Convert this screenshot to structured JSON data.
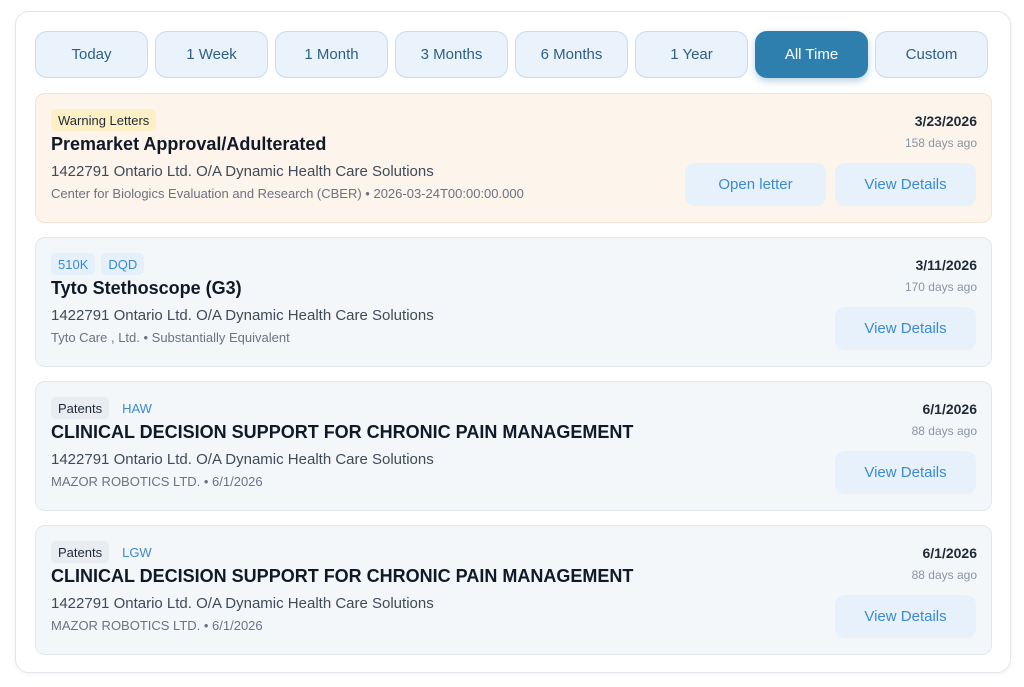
{
  "filters": [
    {
      "label": "Today",
      "active": false
    },
    {
      "label": "1 Week",
      "active": false
    },
    {
      "label": "1 Month",
      "active": false
    },
    {
      "label": "3 Months",
      "active": false
    },
    {
      "label": "6 Months",
      "active": false
    },
    {
      "label": "1 Year",
      "active": false
    },
    {
      "label": "All Time",
      "active": true
    },
    {
      "label": "Custom",
      "active": false
    }
  ],
  "cards": [
    {
      "tags": [
        "Warning Letters"
      ],
      "title": "Premarket Approval/Adulterated",
      "company": "1422791 Ontario Ltd. O/A Dynamic Health Care Solutions",
      "meta": "Center for Biologics Evaluation and Research (CBER) • 2026-03-24T00:00:00.000",
      "date": "3/23/2026",
      "ago": "158 days ago",
      "open_letter_label": "Open letter",
      "details_label": "View Details"
    },
    {
      "tags": [
        "510K",
        "DQD"
      ],
      "title": "Tyto Stethoscope (G3)",
      "company": "1422791 Ontario Ltd. O/A Dynamic Health Care Solutions",
      "meta": "Tyto Care , Ltd. • Substantially Equivalent",
      "date": "3/11/2026",
      "ago": "170 days ago",
      "details_label": "View Details"
    },
    {
      "tags": [
        "Patents",
        "HAW"
      ],
      "title": "CLINICAL DECISION SUPPORT FOR CHRONIC PAIN MANAGEMENT",
      "company": "1422791 Ontario Ltd. O/A Dynamic Health Care Solutions",
      "meta": "MAZOR ROBOTICS LTD. • 6/1/2026",
      "date": "6/1/2026",
      "ago": "88 days ago",
      "details_label": "View Details"
    },
    {
      "tags": [
        "Patents",
        "LGW"
      ],
      "title": "CLINICAL DECISION SUPPORT FOR CHRONIC PAIN MANAGEMENT",
      "company": "1422791 Ontario Ltd. O/A Dynamic Health Care Solutions",
      "meta": "MAZOR ROBOTICS LTD. • 6/1/2026",
      "date": "6/1/2026",
      "ago": "88 days ago",
      "details_label": "View Details"
    }
  ],
  "colors": {
    "accent": "#2f7fae",
    "warning_card_bg": "#fdf4ec",
    "link_blue": "#3b8bd0"
  }
}
